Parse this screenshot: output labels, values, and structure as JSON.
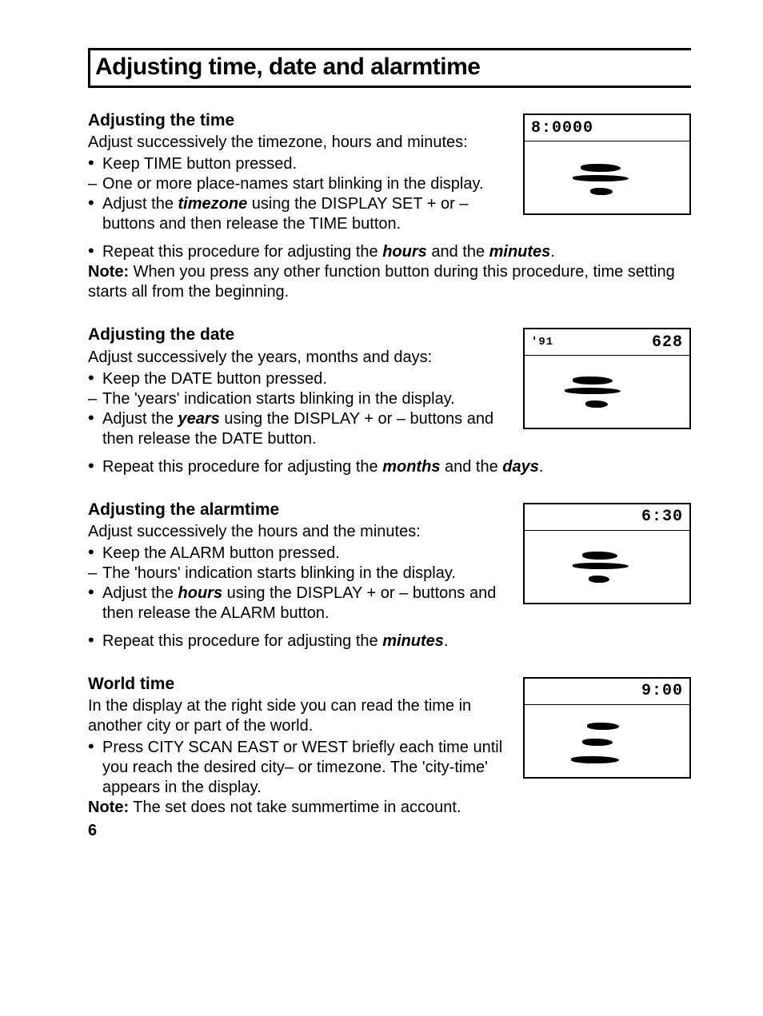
{
  "title": "Adjusting time, date and alarmtime",
  "page_number": "6",
  "sections": {
    "time": {
      "subhead": "Adjusting the time",
      "lead": "Adjust successively the timezone, hours and minutes:",
      "items": [
        {
          "marker": "bullet",
          "text": "Keep TIME button pressed."
        },
        {
          "marker": "dash",
          "text": "One or more place-names start blinking in the display."
        },
        {
          "marker": "bullet",
          "pre": "Adjust the ",
          "bi": "timezone",
          "post": " using the DISPLAY SET + or – buttons and then release the TIME button."
        }
      ],
      "after": {
        "repeat": {
          "pre": "Repeat this procedure for adjusting the ",
          "bi1": "hours",
          "mid": " and the ",
          "bi2": "minutes",
          "post": "."
        },
        "note_label": "Note:",
        "note_text": " When you press any other function button during this procedure, time setting starts all from the beginning."
      },
      "display": {
        "left": "8:00",
        "right": "00"
      }
    },
    "date": {
      "subhead": "Adjusting the date",
      "lead": "Adjust successively the years, months and days:",
      "items": [
        {
          "marker": "bullet",
          "text": "Keep the DATE button pressed."
        },
        {
          "marker": "dash",
          "text": "The 'years' indication starts blinking in the display."
        },
        {
          "marker": "bullet",
          "pre": "Adjust the ",
          "bi": "years",
          "post": " using the DISPLAY + or – buttons and then release the DATE button."
        }
      ],
      "after": {
        "repeat": {
          "pre": "Repeat this procedure for adjusting the ",
          "bi1": "months",
          "mid": " and the ",
          "bi2": "days",
          "post": "."
        }
      },
      "display": {
        "left": "'91",
        "right": "628"
      }
    },
    "alarm": {
      "subhead": "Adjusting the alarmtime",
      "lead": "Adjust successively the hours and the minutes:",
      "items": [
        {
          "marker": "bullet",
          "text": "Keep the ALARM button pressed."
        },
        {
          "marker": "dash",
          "text": "The 'hours' indication starts blinking in the display."
        },
        {
          "marker": "bullet",
          "pre": "Adjust the ",
          "bi": "hours",
          "post": " using the DISPLAY + or – buttons and then release the ALARM button."
        }
      ],
      "after": {
        "repeat": {
          "pre": "Repeat this procedure for adjusting the ",
          "bi1": "minutes",
          "post": "."
        }
      },
      "display": {
        "right": "6:30"
      }
    },
    "world": {
      "subhead": "World time",
      "lead": "In the display at the right side you can read the time in another city or part of the world.",
      "items": [
        {
          "marker": "bullet",
          "text": "Press CITY SCAN EAST or WEST briefly each time until you reach the desired city– or timezone. The 'city-time' appears in the display."
        }
      ],
      "after": {
        "note_label": "Note:",
        "note_text": " The set does not take summertime in account."
      },
      "display": {
        "right": "9:00"
      }
    }
  }
}
